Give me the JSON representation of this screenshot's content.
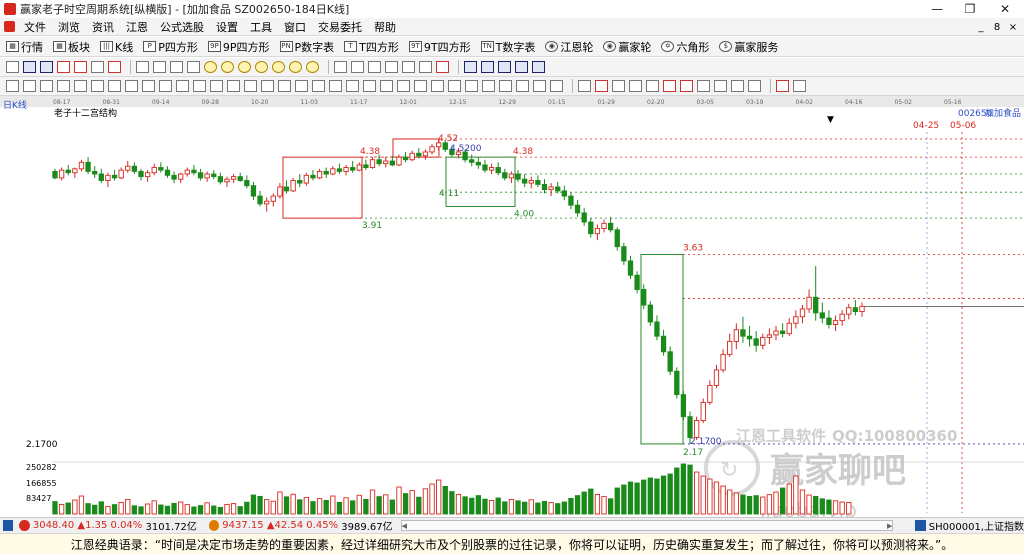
{
  "window": {
    "title": "赢家老子时空周期系统[纵横版] - [加加食品  SZ002650-184日K线]",
    "minimize": "—",
    "restore": "❐",
    "close": "✕"
  },
  "menu": {
    "items": [
      "文件",
      "浏览",
      "资讯",
      "江恩",
      "公式选股",
      "设置",
      "工具",
      "窗口",
      "交易委托",
      "帮助"
    ],
    "mdi": [
      "_",
      "8",
      "×"
    ]
  },
  "toolbar": {
    "items": [
      {
        "icon": "▦",
        "label": "行情"
      },
      {
        "icon": "▦",
        "label": "板块"
      },
      {
        "icon": "|||",
        "label": "K线"
      },
      {
        "icon": "P",
        "label": "P四方形"
      },
      {
        "icon": "9P",
        "label": "9P四方形"
      },
      {
        "icon": "PN",
        "label": "P数字表"
      },
      {
        "icon": "T",
        "label": "T四方形"
      },
      {
        "icon": "9T",
        "label": "9T四方形"
      },
      {
        "icon": "TN",
        "label": "T数字表"
      },
      {
        "icon": "◉",
        "label": "江恩轮"
      },
      {
        "icon": "◉",
        "label": "赢家轮"
      },
      {
        "icon": "✡",
        "label": "六角形"
      },
      {
        "icon": "$",
        "label": "赢家服务"
      }
    ]
  },
  "chart": {
    "period_label": "日K线",
    "indicator_title": "老子十二宫结构",
    "stock_code": "002650",
    "stock_name": "加加食品",
    "date_axis": [
      "08-17",
      "08-31",
      "09-14",
      "09-28",
      "10-20",
      "11-03",
      "11-17",
      "12-01",
      "12-15",
      "12-29",
      "01-15",
      "01-29",
      "02-20",
      "03-05",
      "03-19",
      "04-02",
      "04-16",
      "05-02",
      "05-16"
    ],
    "future_dates": [
      "04-25",
      "05-06"
    ],
    "price_levels": {
      "p438a": "4.38",
      "p452": "4.52",
      "p452b": "4.5200",
      "p438b": "4.38",
      "p391": "3.91",
      "p411": "4.11",
      "p400": "4.00",
      "p363": "3.63",
      "p217axis": "2.1700",
      "p217line": "2.1700",
      "p217": "2.17"
    },
    "volume_axis": [
      "250282",
      "166855",
      "83427"
    ],
    "watermark": {
      "line1": "江恩工具软件",
      "line2": "QQ:100800360",
      "line3": "赢家聊吧",
      "line4": "jiaoba.vip"
    },
    "colors": {
      "up": "#d6281e",
      "down": "#1a8a1a",
      "box_red": "#d6281e",
      "box_green": "#2a8a2a",
      "level_red": "#d6281e",
      "level_green": "#2a8a2a",
      "level_blue": "#3a3ab0"
    }
  },
  "chart_data": {
    "type": "candlestick",
    "title": "老子十二宫结构",
    "symbol": "SZ002650",
    "ohlc": [
      [
        4.27,
        4.29,
        4.21,
        4.22
      ],
      [
        4.22,
        4.3,
        4.2,
        4.28
      ],
      [
        4.28,
        4.32,
        4.24,
        4.26
      ],
      [
        4.26,
        4.3,
        4.22,
        4.29
      ],
      [
        4.29,
        4.36,
        4.27,
        4.34
      ],
      [
        4.34,
        4.38,
        4.25,
        4.27
      ],
      [
        4.27,
        4.31,
        4.22,
        4.25
      ],
      [
        4.25,
        4.29,
        4.18,
        4.2
      ],
      [
        4.2,
        4.26,
        4.15,
        4.24
      ],
      [
        4.24,
        4.28,
        4.2,
        4.22
      ],
      [
        4.22,
        4.3,
        4.21,
        4.28
      ],
      [
        4.28,
        4.35,
        4.26,
        4.31
      ],
      [
        4.31,
        4.34,
        4.25,
        4.27
      ],
      [
        4.27,
        4.29,
        4.2,
        4.23
      ],
      [
        4.23,
        4.28,
        4.19,
        4.26
      ],
      [
        4.26,
        4.33,
        4.24,
        4.3
      ],
      [
        4.3,
        4.34,
        4.26,
        4.28
      ],
      [
        4.28,
        4.31,
        4.22,
        4.24
      ],
      [
        4.24,
        4.27,
        4.18,
        4.21
      ],
      [
        4.21,
        4.26,
        4.18,
        4.25
      ],
      [
        4.25,
        4.3,
        4.23,
        4.28
      ],
      [
        4.28,
        4.32,
        4.24,
        4.26
      ],
      [
        4.26,
        4.29,
        4.2,
        4.22
      ],
      [
        4.22,
        4.27,
        4.19,
        4.25
      ],
      [
        4.25,
        4.28,
        4.21,
        4.23
      ],
      [
        4.23,
        4.26,
        4.17,
        4.19
      ],
      [
        4.19,
        4.23,
        4.15,
        4.21
      ],
      [
        4.21,
        4.25,
        4.18,
        4.23
      ],
      [
        4.23,
        4.26,
        4.19,
        4.2
      ],
      [
        4.2,
        4.24,
        4.14,
        4.16
      ],
      [
        4.16,
        4.19,
        4.05,
        4.08
      ],
      [
        4.08,
        4.12,
        4.0,
        4.02
      ],
      [
        4.02,
        4.07,
        3.96,
        4.04
      ],
      [
        4.04,
        4.1,
        4.0,
        4.08
      ],
      [
        4.08,
        4.18,
        4.06,
        4.15
      ],
      [
        4.15,
        4.2,
        4.1,
        4.12
      ],
      [
        4.12,
        4.22,
        4.11,
        4.2
      ],
      [
        4.2,
        4.25,
        4.15,
        4.18
      ],
      [
        4.18,
        4.26,
        4.16,
        4.24
      ],
      [
        4.24,
        4.28,
        4.2,
        4.22
      ],
      [
        4.22,
        4.29,
        4.21,
        4.27
      ],
      [
        4.27,
        4.3,
        4.22,
        4.25
      ],
      [
        4.25,
        4.31,
        4.24,
        4.29
      ],
      [
        4.29,
        4.33,
        4.25,
        4.27
      ],
      [
        4.27,
        4.32,
        4.24,
        4.3
      ],
      [
        4.3,
        4.35,
        4.26,
        4.28
      ],
      [
        4.28,
        4.34,
        4.27,
        4.32
      ],
      [
        4.32,
        4.36,
        4.28,
        4.3
      ],
      [
        4.3,
        4.38,
        4.29,
        4.36
      ],
      [
        4.36,
        4.4,
        4.31,
        4.33
      ],
      [
        4.33,
        4.38,
        4.3,
        4.35
      ],
      [
        4.35,
        4.39,
        4.31,
        4.32
      ],
      [
        4.32,
        4.4,
        4.31,
        4.38
      ],
      [
        4.38,
        4.42,
        4.34,
        4.36
      ],
      [
        4.36,
        4.43,
        4.35,
        4.41
      ],
      [
        4.41,
        4.45,
        4.37,
        4.39
      ],
      [
        4.39,
        4.44,
        4.36,
        4.42
      ],
      [
        4.42,
        4.48,
        4.4,
        4.46
      ],
      [
        4.46,
        4.52,
        4.43,
        4.49
      ],
      [
        4.49,
        4.51,
        4.42,
        4.44
      ],
      [
        4.44,
        4.47,
        4.38,
        4.4
      ],
      [
        4.4,
        4.45,
        4.37,
        4.42
      ],
      [
        4.42,
        4.44,
        4.34,
        4.36
      ],
      [
        4.36,
        4.4,
        4.31,
        4.34
      ],
      [
        4.34,
        4.38,
        4.29,
        4.32
      ],
      [
        4.32,
        4.36,
        4.26,
        4.28
      ],
      [
        4.28,
        4.33,
        4.25,
        4.3
      ],
      [
        4.3,
        4.34,
        4.24,
        4.26
      ],
      [
        4.26,
        4.29,
        4.2,
        4.22
      ],
      [
        4.22,
        4.27,
        4.18,
        4.25
      ],
      [
        4.25,
        4.28,
        4.19,
        4.21
      ],
      [
        4.21,
        4.25,
        4.15,
        4.18
      ],
      [
        4.18,
        4.23,
        4.14,
        4.2
      ],
      [
        4.2,
        4.24,
        4.15,
        4.17
      ],
      [
        4.17,
        4.21,
        4.1,
        4.13
      ],
      [
        4.13,
        4.18,
        4.08,
        4.15
      ],
      [
        4.15,
        4.19,
        4.1,
        4.12
      ],
      [
        4.12,
        4.16,
        4.05,
        4.08
      ],
      [
        4.08,
        4.11,
        3.98,
        4.01
      ],
      [
        4.01,
        4.05,
        3.92,
        3.95
      ],
      [
        3.95,
        3.99,
        3.85,
        3.88
      ],
      [
        3.88,
        3.91,
        3.76,
        3.79
      ],
      [
        3.79,
        3.86,
        3.74,
        3.83
      ],
      [
        3.83,
        3.9,
        3.8,
        3.87
      ],
      [
        3.87,
        3.92,
        3.8,
        3.82
      ],
      [
        3.82,
        3.84,
        3.66,
        3.69
      ],
      [
        3.69,
        3.72,
        3.55,
        3.58
      ],
      [
        3.58,
        3.62,
        3.44,
        3.47
      ],
      [
        3.47,
        3.5,
        3.33,
        3.36
      ],
      [
        3.36,
        3.4,
        3.21,
        3.24
      ],
      [
        3.24,
        3.27,
        3.08,
        3.11
      ],
      [
        3.11,
        3.16,
        2.97,
        3.0
      ],
      [
        3.0,
        3.05,
        2.85,
        2.88
      ],
      [
        2.88,
        2.92,
        2.7,
        2.73
      ],
      [
        2.73,
        2.76,
        2.52,
        2.55
      ],
      [
        2.55,
        2.58,
        2.35,
        2.38
      ],
      [
        2.38,
        2.42,
        2.17,
        2.22
      ],
      [
        2.22,
        2.38,
        2.2,
        2.35
      ],
      [
        2.35,
        2.52,
        2.33,
        2.49
      ],
      [
        2.49,
        2.66,
        2.47,
        2.62
      ],
      [
        2.62,
        2.78,
        2.6,
        2.74
      ],
      [
        2.74,
        2.9,
        2.72,
        2.86
      ],
      [
        2.86,
        3.02,
        2.84,
        2.96
      ],
      [
        2.96,
        3.1,
        2.9,
        3.05
      ],
      [
        3.05,
        3.15,
        2.95,
        3.0
      ],
      [
        3.0,
        3.08,
        2.92,
        2.98
      ],
      [
        2.98,
        3.04,
        2.88,
        2.93
      ],
      [
        2.93,
        3.02,
        2.9,
        2.99
      ],
      [
        2.99,
        3.06,
        2.94,
        3.01
      ],
      [
        3.01,
        3.08,
        2.97,
        3.04
      ],
      [
        3.04,
        3.1,
        2.99,
        3.02
      ],
      [
        3.02,
        3.14,
        3.0,
        3.1
      ],
      [
        3.1,
        3.2,
        3.06,
        3.15
      ],
      [
        3.15,
        3.24,
        3.1,
        3.21
      ],
      [
        3.21,
        3.36,
        3.18,
        3.3
      ],
      [
        3.3,
        3.54,
        3.12,
        3.18
      ],
      [
        3.18,
        3.26,
        3.1,
        3.14
      ],
      [
        3.14,
        3.2,
        3.06,
        3.09
      ],
      [
        3.09,
        3.16,
        3.04,
        3.12
      ],
      [
        3.12,
        3.2,
        3.08,
        3.17
      ],
      [
        3.17,
        3.25,
        3.13,
        3.22
      ],
      [
        3.22,
        3.28,
        3.16,
        3.19
      ],
      [
        3.19,
        3.26,
        3.15,
        3.23
      ]
    ],
    "volume": [
      62000,
      48000,
      55000,
      70000,
      90000,
      52000,
      44000,
      61000,
      38000,
      47000,
      58000,
      73000,
      41000,
      36000,
      50000,
      66000,
      45000,
      39000,
      53000,
      60000,
      47000,
      35000,
      42000,
      56000,
      40000,
      33000,
      48000,
      52000,
      37000,
      59000,
      95000,
      88000,
      72000,
      64000,
      110000,
      86000,
      99000,
      71000,
      83000,
      62000,
      77000,
      68000,
      90000,
      58000,
      81000,
      66000,
      94000,
      73000,
      120000,
      87000,
      96000,
      70000,
      135000,
      102000,
      118000,
      84000,
      126000,
      150000,
      170000,
      138000,
      112000,
      98000,
      86000,
      79000,
      92000,
      74000,
      68000,
      80000,
      61000,
      73000,
      66000,
      59000,
      71000,
      55000,
      63000,
      57000,
      52000,
      60000,
      78000,
      92000,
      110000,
      125000,
      98000,
      87000,
      76000,
      130000,
      145000,
      160000,
      155000,
      170000,
      180000,
      175000,
      190000,
      200000,
      230000,
      250282,
      245000,
      210000,
      190000,
      175000,
      160000,
      140000,
      120000,
      105000,
      95000,
      88000,
      92000,
      85000,
      97000,
      110000,
      130000,
      150000,
      190000,
      120000,
      95000,
      88000,
      76000,
      70000,
      66000,
      60000,
      58000
    ],
    "price_ylim": [
      2.1,
      4.62
    ],
    "levels": [
      4.52,
      4.38,
      4.11,
      4.0,
      3.91,
      3.63,
      2.17
    ]
  },
  "status": {
    "sh_index": "3048.40",
    "sh_change": "▲1.35 0.04%",
    "sh_amount": "3101.72亿",
    "sz_index": "9437.15",
    "sz_change": "▲42.54 0.45%",
    "sz_amount": "3989.67亿",
    "right_label": "SH000001,上证指数"
  },
  "quote": {
    "text": "江恩经典语录：“时间是决定市场走势的重要因素，经过详细研究大市及个别股票的过往记录，你将可以证明，历史确实重复发生；而了解过往，你将可以预测将来。”。"
  }
}
